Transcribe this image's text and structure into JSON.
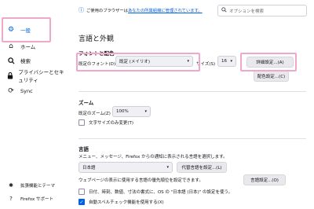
{
  "sidebar": {
    "items": [
      {
        "label": "一般",
        "icon": "gear-icon"
      },
      {
        "label": "ホーム",
        "icon": "home-icon"
      },
      {
        "label": "検索",
        "icon": "search-icon"
      },
      {
        "label": "プライバシーとセキュリティ",
        "icon": "lock-icon"
      },
      {
        "label": "Sync",
        "icon": "sync-icon"
      }
    ],
    "footer": [
      {
        "label": "拡張機能とテーマ",
        "icon": "puzzle-icon"
      },
      {
        "label": "Firefox サポート",
        "icon": "help-icon"
      }
    ]
  },
  "header": {
    "notice_text": "ご使用のブラウザーは",
    "notice_link": "あなたの所属組織に管理されています。",
    "search_placeholder": "オプションを検索"
  },
  "main": {
    "title": "言語と外観",
    "fonts": {
      "heading": "フォントと配色",
      "default_font_label": "既定のフォント(D)",
      "default_font_value": "既定 (メイリオ)",
      "size_label": "サイズ(S)",
      "size_value": "16",
      "advanced_button": "詳細設定...(A)",
      "colors_button": "配色設定...(C)"
    },
    "zoom": {
      "heading": "ズーム",
      "default_zoom_label": "既定のズーム(Z)",
      "default_zoom_value": "100%",
      "text_only_label": "文字サイズのみ変更(T)"
    },
    "language": {
      "heading": "言語",
      "description": "メニュー、メッセージ、Firefox からの通知に表示される言語を選択します。",
      "language_value": "日本語",
      "alternatives_button": "代替言語を設定...(L)",
      "webpage_desc": "ウェブページの表示に使用する言語の優先順位を設定できます。",
      "choose_button": "言語設定...(O)",
      "regional_label": "日付、時刻、数値、寸法の書式に、OS の \"日本語 (日本)\" の設定を使う。",
      "spellcheck_label": "自動スペルチェック機能を使用する(X)"
    }
  },
  "colors": {
    "accent": "#0061e0",
    "highlight": "#f0a7cc"
  }
}
